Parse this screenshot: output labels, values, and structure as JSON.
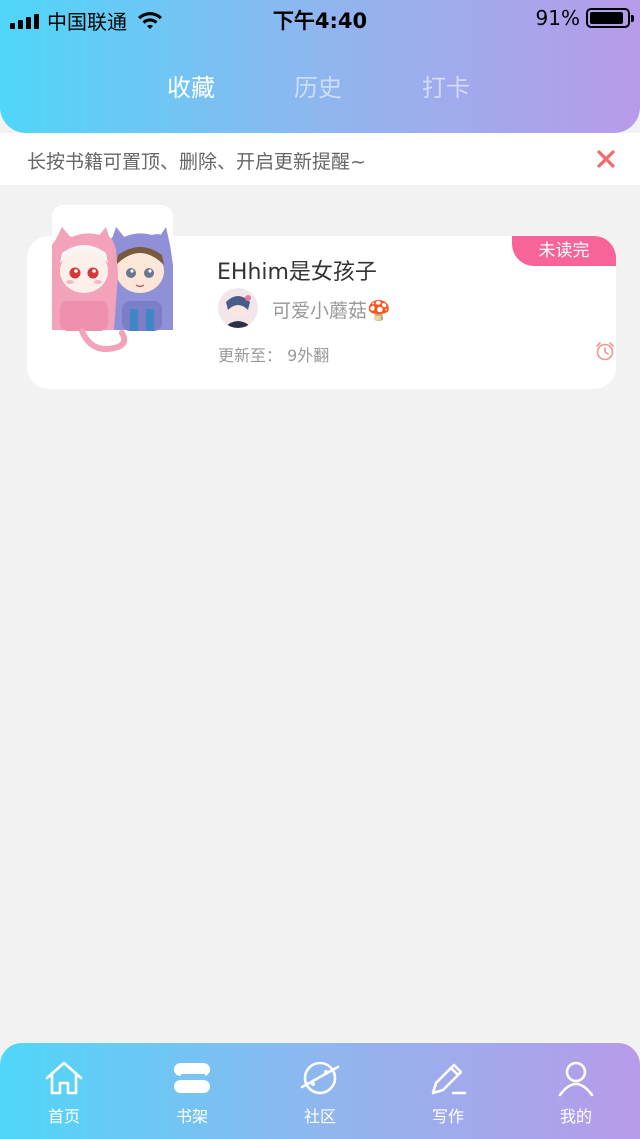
{
  "status_bar": {
    "carrier": "中国联通",
    "time": "下午4:40",
    "battery": "91%",
    "battery_level": 0.91
  },
  "header": {
    "tabs": [
      {
        "label": "收藏",
        "active": true
      },
      {
        "label": "历史",
        "active": false
      },
      {
        "label": "打卡",
        "active": false
      }
    ]
  },
  "tip": {
    "text": "长按书籍可置顶、删除、开启更新提醒~",
    "close_icon": "close-icon"
  },
  "books": [
    {
      "title": "EHhim是女孩子",
      "author": "可爱小蘑菇🍄",
      "badge": "未读完",
      "update_label": "更新至：",
      "update_value": "9外翻",
      "icon": "alarm-icon"
    }
  ],
  "bottom_nav": [
    {
      "label": "首页",
      "icon": "home-icon"
    },
    {
      "label": "书架",
      "icon": "bookshelf-icon"
    },
    {
      "label": "社区",
      "icon": "planet-icon"
    },
    {
      "label": "写作",
      "icon": "pen-icon"
    },
    {
      "label": "我的",
      "icon": "user-icon"
    }
  ],
  "colors": {
    "gradient_start": "#4fd6f8",
    "gradient_end": "#b79bea",
    "badge": "#f7649a",
    "close": "#f16a6a",
    "background": "#f2f2f2"
  }
}
